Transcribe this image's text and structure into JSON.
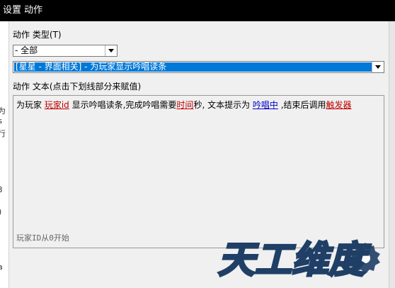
{
  "window": {
    "title": "设置 动作"
  },
  "action_type": {
    "label": "动作 类型(T)",
    "selected": "- 全部"
  },
  "action_select": {
    "selected": "[星星 - 界面相关] - 为玩家显示吟唱读条"
  },
  "action_text": {
    "label": "动作 文本(点击下划线部分来赋值)",
    "segments": {
      "t1": "为玩家 ",
      "l1": "玩家id",
      "t2": " 显示吟唱读条,完成吟唱需要",
      "l2": "时间",
      "t3": "秒, 文本提示为 ",
      "l3": "吟唱中",
      "t4": " ,结束后调用",
      "l4": "触发器"
    },
    "hint": "玩家ID从0开始"
  },
  "behind_window": {
    "fragments": [
      "为",
      "s",
      "行",
      "3",
      ")",
      "a"
    ]
  },
  "watermark": {
    "text": "天工维度"
  },
  "colors": {
    "selection": "#0078d7",
    "link_red": "#c00000",
    "link_blue": "#0000cc",
    "title_bg": "#000000"
  }
}
